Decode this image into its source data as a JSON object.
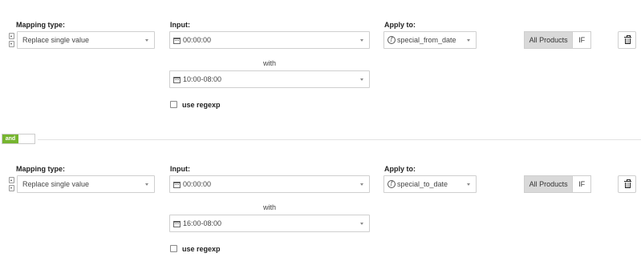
{
  "rules": [
    {
      "mapping_type_label": "Mapping type:",
      "mapping_type_value": "Replace single value",
      "input_label": "Input:",
      "input_value": "00:00:00",
      "with_label": "with",
      "with_value": "10:00-08:00",
      "use_regexp_label": "use regexp",
      "apply_to_label": "Apply to:",
      "apply_to_value": "special_from_date",
      "scope_options": [
        "All Products",
        "IF"
      ],
      "scope_selected": "All Products"
    },
    {
      "mapping_type_label": "Mapping type:",
      "mapping_type_value": "Replace single value",
      "input_label": "Input:",
      "input_value": "00:00:00",
      "with_label": "with",
      "with_value": "16:00-08:00",
      "use_regexp_label": "use regexp",
      "apply_to_label": "Apply to:",
      "apply_to_value": "special_to_date",
      "scope_options": [
        "All Products",
        "IF"
      ],
      "scope_selected": "All Products"
    }
  ],
  "and_toggle": {
    "label": "and",
    "state": "on",
    "color": "#76b52f"
  },
  "icons": {
    "stepper": "up-down-arrows-icon",
    "calendar": "calendar-icon",
    "function": "function-icon",
    "delete": "trash-icon",
    "dropdown": "chevron-down-icon"
  }
}
